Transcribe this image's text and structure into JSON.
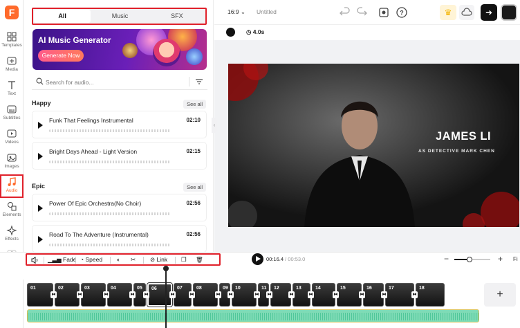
{
  "rail": {
    "logo": "F",
    "items": [
      {
        "label": "Templates",
        "icon": "templates-icon"
      },
      {
        "label": "Media",
        "icon": "media-icon"
      },
      {
        "label": "Text",
        "icon": "text-icon"
      },
      {
        "label": "Subtitles",
        "icon": "subtitles-icon"
      },
      {
        "label": "Videos",
        "icon": "videos-icon"
      },
      {
        "label": "Images",
        "icon": "images-icon"
      },
      {
        "label": "Audio",
        "icon": "audio-icon",
        "active": true
      },
      {
        "label": "Elements",
        "icon": "elements-icon"
      },
      {
        "label": "Effects",
        "icon": "effects-icon"
      },
      {
        "label": "Tools",
        "icon": "tools-icon"
      }
    ]
  },
  "panel": {
    "tabs": [
      "All",
      "Music",
      "SFX"
    ],
    "active_tab": "All",
    "banner": {
      "title": "AI Music Generator",
      "button": "Generate Now"
    },
    "search_placeholder": "Search for audio...",
    "sections": [
      {
        "title": "Happy",
        "see_all": "See all",
        "tracks": [
          {
            "name": "Funk That Feelings Instrumental",
            "duration": "02:10"
          },
          {
            "name": "Bright Days Ahead - Light Version",
            "duration": "02:15"
          }
        ]
      },
      {
        "title": "Epic",
        "see_all": "See all",
        "tracks": [
          {
            "name": "Power Of Epic Orchestra(No Choir)",
            "duration": "02:56"
          },
          {
            "name": "Road To The Adventure (Instrumental)",
            "duration": "02:56"
          }
        ]
      }
    ]
  },
  "topbar": {
    "ratio": "16:9",
    "project_title": "Untitled"
  },
  "stage": {
    "clip_duration": "4.0s",
    "video_title": "JAMES LI",
    "video_subtitle": "AS DETECTIVE MARK CHEN"
  },
  "timeline": {
    "tools": {
      "fade": "Fade",
      "speed": "Speed",
      "link": "Link"
    },
    "current_time": "00:16.4",
    "total_time": "/ 00:53.0",
    "fit_label": "Fi",
    "zoom_level": 0.42,
    "add_label": "+",
    "clips": [
      "01",
      "02",
      "03",
      "04",
      "05",
      "06",
      "07",
      "08",
      "09",
      "10",
      "11",
      "12",
      "13",
      "14",
      "15",
      "16",
      "17",
      "18"
    ],
    "selected_clip": "06"
  },
  "colors": {
    "accent": "#ff6a2b",
    "highlight": "#e0202a",
    "audio_track": "#7fdbb6"
  }
}
